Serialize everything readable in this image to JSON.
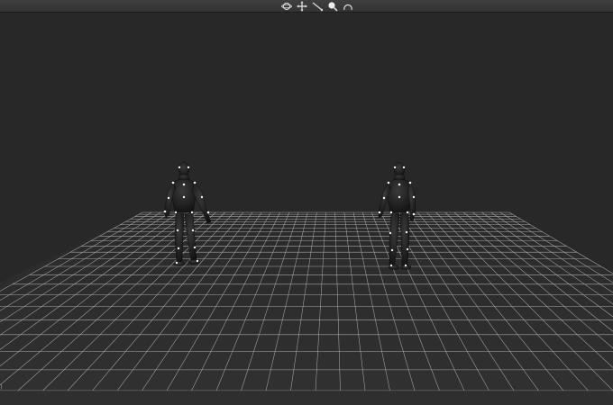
{
  "toolbar": {
    "tools": [
      {
        "icon": "orbit-icon"
      },
      {
        "icon": "move-icon"
      },
      {
        "icon": "line-icon"
      },
      {
        "icon": "zoom-icon"
      },
      {
        "icon": "undo-icon"
      }
    ]
  },
  "viewport": {
    "background": "#282828",
    "grid_color": "#bdbdbd",
    "actors": [
      {
        "name": "actor-left"
      },
      {
        "name": "actor-right"
      }
    ],
    "edge_label": ")"
  },
  "statusbar": {
    "text": ""
  }
}
